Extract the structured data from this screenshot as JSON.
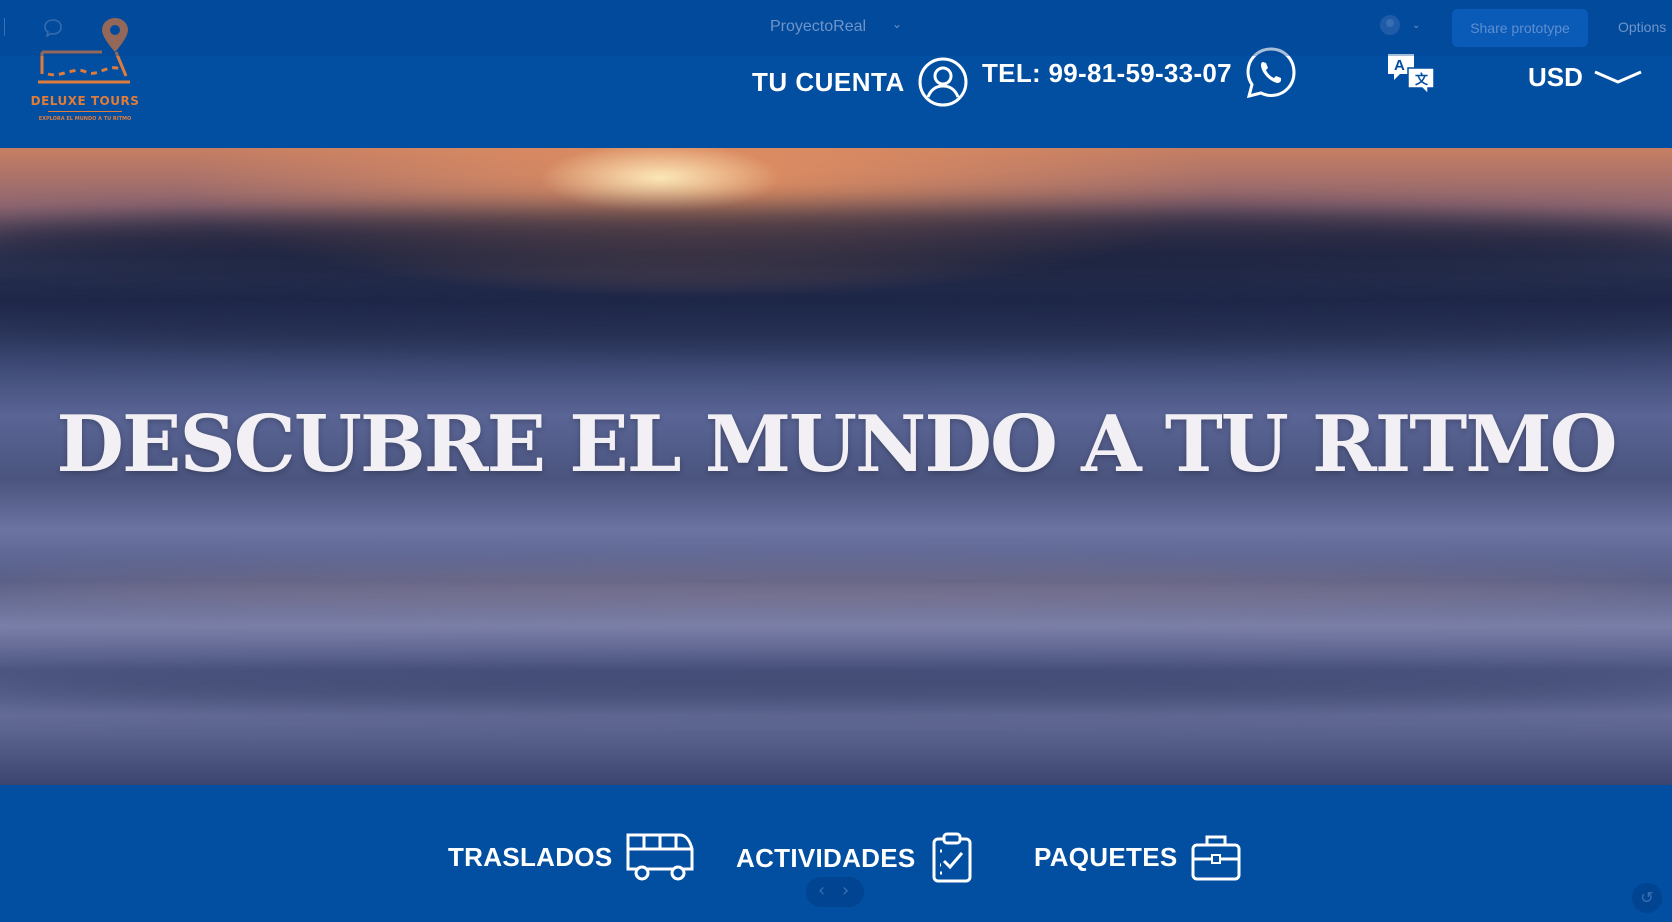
{
  "toolbar": {
    "project_title": "ProyectoReal",
    "share_label": "Share prototype",
    "options_label": "Options"
  },
  "header": {
    "brand_name": "DELUXE TOURS",
    "brand_tagline": "EXPLORA EL MUNDO A TU RITMO",
    "account_label": "TU CUENTA",
    "phone_label": "TEL: 99-81-59-33-07",
    "currency_label": "USD"
  },
  "hero": {
    "headline": "DESCUBRE EL MUNDO A TU RITMO"
  },
  "nav": {
    "traslados": "TRASLADOS",
    "actividades": "ACTIVIDADES",
    "paquetes": "PAQUETES"
  },
  "colors": {
    "primary": "#024ea0",
    "logo_orange": "#e07c3a",
    "text": "#ffffff"
  },
  "icons": [
    "chat-bubble-icon",
    "chevron-down-icon",
    "user-icon",
    "whatsapp-icon",
    "translate-icon",
    "bus-icon",
    "clipboard-check-icon",
    "briefcase-icon",
    "map-pin-icon"
  ]
}
